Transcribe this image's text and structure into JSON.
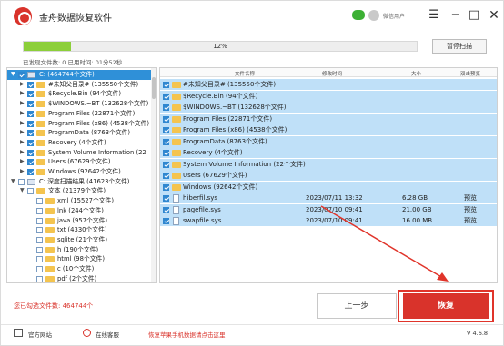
{
  "app": {
    "title": "金舟数据恢复软件",
    "user_label": "微信用户"
  },
  "window_controls": {
    "menu": "☰",
    "minimize": "−",
    "maximize": "□",
    "close": "✕"
  },
  "scan": {
    "progress_percent": 12,
    "progress_text": "12%",
    "pause_label": "暂停扫描",
    "status_text": "已发现文件数: 0   已用时间: 01分52秒"
  },
  "tree": [
    {
      "label": "C: (464744个文件)",
      "state": "checked",
      "icon": "drive-icon",
      "selected": true,
      "arrow": "▼"
    },
    {
      "label": "#未知父目录# (135550个文件)",
      "state": "checked",
      "icon": "folder-icon",
      "arrow": "▶"
    },
    {
      "label": "$Recycle.Bin (94个文件)",
      "state": "checked",
      "icon": "folder-icon",
      "arrow": "▶"
    },
    {
      "label": "$WINDOWS.~BT (132628个文件)",
      "state": "checked",
      "icon": "folder-icon",
      "arrow": "▶"
    },
    {
      "label": "Program Files (22871个文件)",
      "state": "checked",
      "icon": "folder-icon",
      "arrow": "▶"
    },
    {
      "label": "Program Files (x86) (4538个文件)",
      "state": "checked",
      "icon": "folder-icon",
      "arrow": "▶"
    },
    {
      "label": "ProgramData (8763个文件)",
      "state": "checked",
      "icon": "folder-icon",
      "arrow": "▶"
    },
    {
      "label": "Recovery (4个文件)",
      "state": "checked",
      "icon": "folder-icon",
      "arrow": "▶"
    },
    {
      "label": "System Volume Information (22",
      "state": "checked",
      "icon": "folder-icon",
      "arrow": "▶"
    },
    {
      "label": "Users (67629个文件)",
      "state": "checked",
      "icon": "folder-icon",
      "arrow": "▶"
    },
    {
      "label": "Windows (92642个文件)",
      "state": "checked",
      "icon": "folder-icon",
      "arrow": "▶"
    },
    {
      "label": "C: 深度扫描结果 (41623个文件)",
      "state": "unchecked",
      "icon": "drive-icon",
      "arrow": "▼"
    },
    {
      "label": "文本 (21379个文件)",
      "state": "unchecked",
      "icon": "folder-icon",
      "arrow": "▼"
    },
    {
      "label": "xml (15527个文件)",
      "state": "unchecked",
      "icon": "folder-icon",
      "arrow": ""
    },
    {
      "label": "lnk (244个文件)",
      "state": "unchecked",
      "icon": "folder-icon",
      "arrow": ""
    },
    {
      "label": "java (957个文件)",
      "state": "unchecked",
      "icon": "folder-icon",
      "arrow": ""
    },
    {
      "label": "txt (4330个文件)",
      "state": "unchecked",
      "icon": "folder-icon",
      "arrow": ""
    },
    {
      "label": "sqlite (21个文件)",
      "state": "unchecked",
      "icon": "folder-icon",
      "arrow": ""
    },
    {
      "label": "h (190个文件)",
      "state": "unchecked",
      "icon": "folder-icon",
      "arrow": ""
    },
    {
      "label": "html (98个文件)",
      "state": "unchecked",
      "icon": "folder-icon",
      "arrow": ""
    },
    {
      "label": "c (10个文件)",
      "state": "unchecked",
      "icon": "folder-icon",
      "arrow": ""
    },
    {
      "label": "pdf (2个文件)",
      "state": "unchecked",
      "icon": "folder-icon",
      "arrow": ""
    }
  ],
  "list": {
    "headers": {
      "name": "文件名称",
      "modified": "修改时间",
      "size": "大小",
      "preview": "双击预览"
    },
    "rows": [
      {
        "name": "#未知父目录# (135550个文件)",
        "type": "folder",
        "date": "",
        "size": "",
        "preview": ""
      },
      {
        "name": "$Recycle.Bin (94个文件)",
        "type": "folder",
        "date": "",
        "size": "",
        "preview": ""
      },
      {
        "name": "$WINDOWS.~BT (132628个文件)",
        "type": "folder",
        "date": "",
        "size": "",
        "preview": ""
      },
      {
        "name": "Program Files (22871个文件)",
        "type": "folder",
        "date": "",
        "size": "",
        "preview": ""
      },
      {
        "name": "Program Files (x86) (4538个文件)",
        "type": "folder",
        "date": "",
        "size": "",
        "preview": ""
      },
      {
        "name": "ProgramData (8763个文件)",
        "type": "folder",
        "date": "",
        "size": "",
        "preview": ""
      },
      {
        "name": "Recovery (4个文件)",
        "type": "folder",
        "date": "",
        "size": "",
        "preview": ""
      },
      {
        "name": "System Volume Information (22个文件)",
        "type": "folder",
        "date": "",
        "size": "",
        "preview": ""
      },
      {
        "name": "Users (67629个文件)",
        "type": "folder",
        "date": "",
        "size": "",
        "preview": ""
      },
      {
        "name": "Windows (92642个文件)",
        "type": "folder",
        "date": "",
        "size": "",
        "preview": ""
      },
      {
        "name": "hiberfil.sys",
        "type": "file",
        "date": "2023/07/11 13:32",
        "size": "6.28 GB",
        "preview": "预览"
      },
      {
        "name": "pagefile.sys",
        "type": "file",
        "date": "2023/07/10 09:41",
        "size": "21.00 GB",
        "preview": "预览"
      },
      {
        "name": "swapfile.sys",
        "type": "file",
        "date": "2023/07/10 09:41",
        "size": "16.00 MB",
        "preview": "预览"
      }
    ]
  },
  "bottom": {
    "selected_count": "您已勾选文件数: 464744个",
    "prev_label": "上一步",
    "recover_label": "恢复"
  },
  "footer": {
    "official_site": "官方网站",
    "online_service": "在线客服",
    "promo_link": "恢复苹果手机数据请点击这里",
    "version": "V 4.6.8"
  },
  "colors": {
    "accent": "#d9332b",
    "selection": "#2f90d8",
    "row_highlight": "#bfe0f8",
    "progress": "#8ccf3a"
  }
}
